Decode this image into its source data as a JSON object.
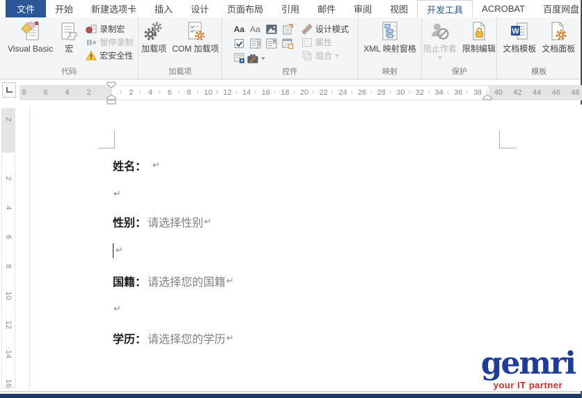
{
  "tabbar": {
    "tabs": [
      "文件",
      "开始",
      "新建选项卡",
      "插入",
      "设计",
      "页面布局",
      "引用",
      "邮件",
      "审阅",
      "视图",
      "开发工具",
      "ACROBAT",
      "百度网盘"
    ]
  },
  "ribbon": {
    "code": {
      "label": "代码",
      "visual_basic": "Visual Basic",
      "macros": "宏",
      "record_macro": "录制宏",
      "pause_recording": "暂停录制",
      "macro_security": "宏安全性"
    },
    "addins": {
      "label": "加载项",
      "addins": "加载项",
      "com_addins": "COM 加载项"
    },
    "controls": {
      "label": "控件",
      "aa_rich": "Aa",
      "aa_plain": "Aa",
      "design_mode": "设计模式",
      "properties": "属性",
      "group": "组合"
    },
    "mapping": {
      "label": "映射",
      "xml_pane": "XML 映射窗格"
    },
    "protect": {
      "label": "保护",
      "block_authors": "阻止作者",
      "restrict_editing": "限制编辑"
    },
    "templates": {
      "label": "模板",
      "doc_template": "文档模板",
      "doc_panel": "文档面板"
    }
  },
  "ruler": {
    "h_left": [
      "8",
      "6",
      "4",
      "2"
    ],
    "h_main": [
      "2",
      "4",
      "6",
      "8",
      "10",
      "12",
      "14",
      "16",
      "18",
      "20",
      "22",
      "24",
      "26",
      "28",
      "30",
      "32",
      "34",
      "36",
      "38"
    ],
    "h_right": [
      "40",
      "42",
      "44",
      "46",
      "48"
    ],
    "v_top": [
      "2"
    ],
    "v_main": [
      "2",
      "4",
      "6",
      "8",
      "10",
      "12",
      "14",
      "16"
    ]
  },
  "document": {
    "lines": [
      {
        "label": "姓名：",
        "placeholder": "",
        "mark": "↵"
      },
      {
        "label": "",
        "placeholder": "",
        "mark": "↵"
      },
      {
        "label": "性别：",
        "placeholder": "请选择性别",
        "mark": "↵"
      },
      {
        "label": "",
        "placeholder": "",
        "mark": "↵"
      },
      {
        "label": "国籍：",
        "placeholder": "请选择您的国籍",
        "mark": "↵"
      },
      {
        "label": "",
        "placeholder": "",
        "mark": "↵"
      },
      {
        "label": "学历：",
        "placeholder": "请选择您的学历",
        "mark": "↵"
      }
    ]
  },
  "watermark": {
    "brand": "gemri",
    "tagline": "your IT partner"
  },
  "colors": {
    "accent": "#2b579a",
    "logo_blue": "#1d3d9e",
    "logo_red": "#e02424",
    "placeholder": "#828282",
    "footer_bar": "#1d3a66"
  }
}
